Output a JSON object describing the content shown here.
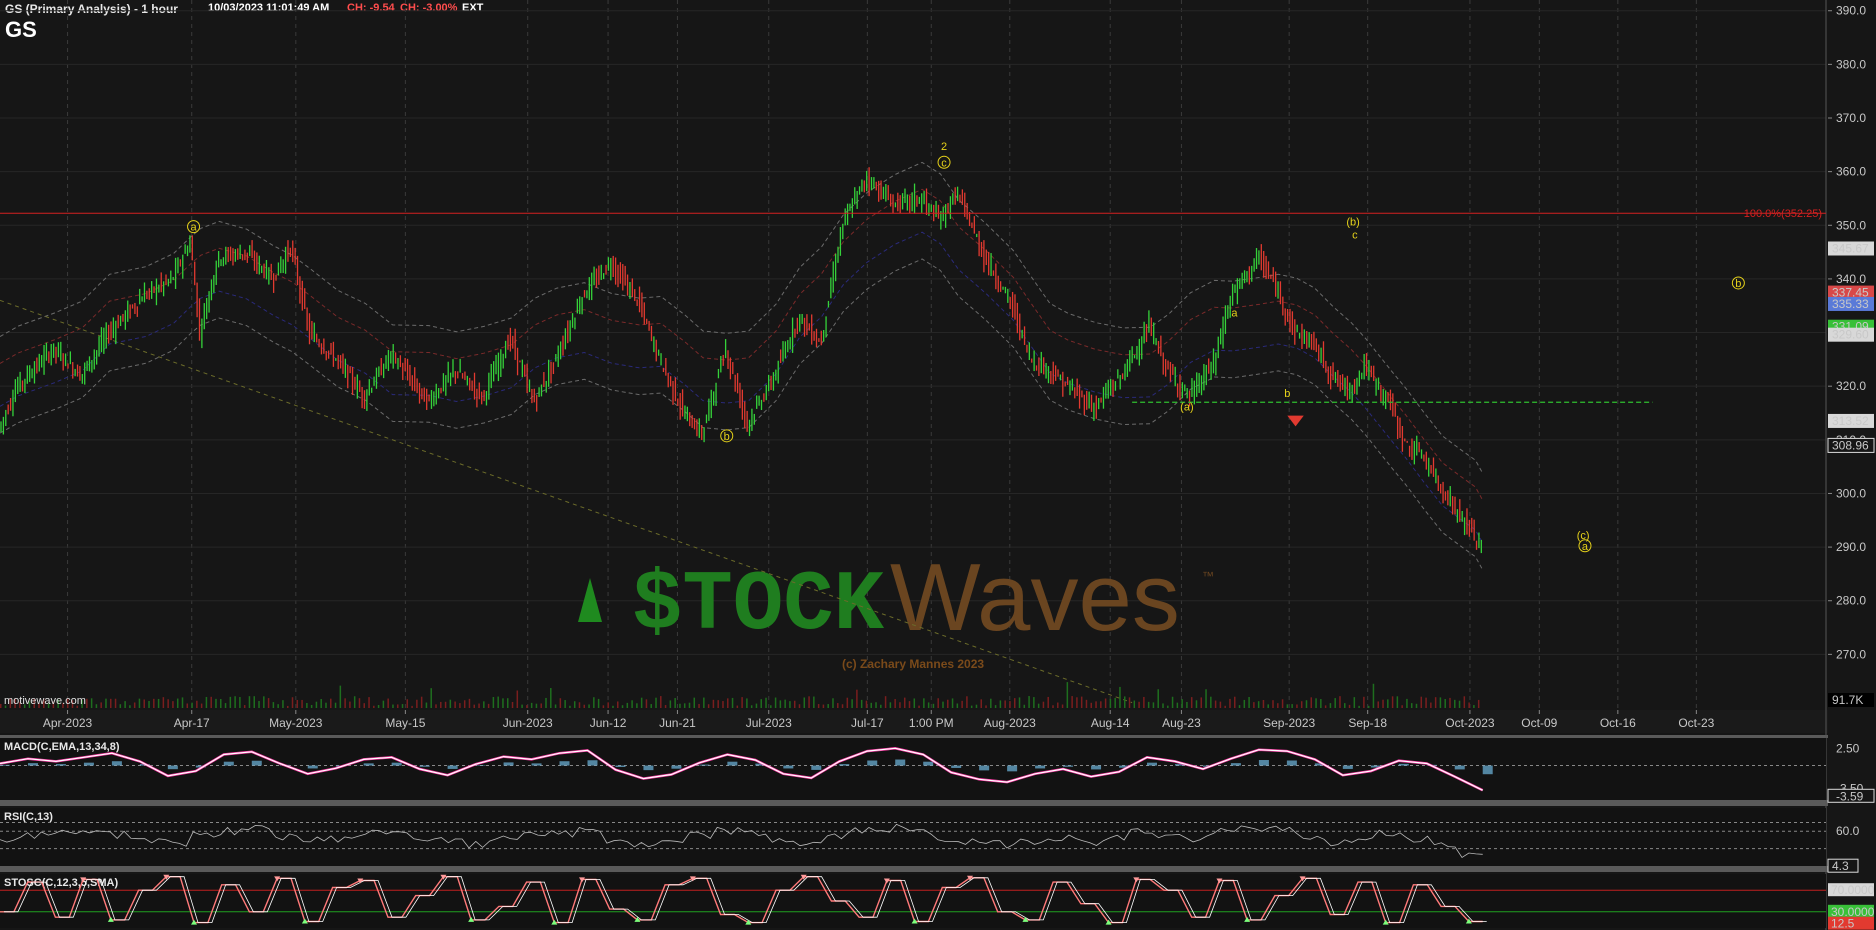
{
  "header": {
    "title": "GS (Primary Analysis) - 1 hour",
    "symbol": "GS",
    "timestamp": "10/03/2023 11:01:49 AM",
    "change": "CH: -9.54",
    "change_pct": "CH: -3.00%",
    "session": "EXT"
  },
  "watermark": {
    "source": "motivewave.com",
    "logo_part1": "$TOCK",
    "logo_part2": "Waves",
    "trademark": "™",
    "copyright": "(c) Zachary Mannes 2023"
  },
  "colors": {
    "background": "#161616",
    "grid": "#3a3a3a",
    "up": "#35d23a",
    "down": "#e23a30",
    "wave_label": "#e6d21a",
    "fib_line": "#d42020",
    "support_line": "#2fbf2f",
    "macd": "#ffffff",
    "macd_signal": "#ff3ca8",
    "macd_hist": "#6fb8e0",
    "stoch_k": "#ff7a7a",
    "stoch_d": "#ffffff"
  },
  "chart_data": [
    {
      "type": "line",
      "name": "price",
      "ylim": [
        260,
        392
      ],
      "y_ticks": [
        270,
        280,
        290,
        300,
        310,
        320,
        330,
        340,
        350,
        360,
        370,
        380,
        390
      ],
      "x_labels": [
        "Apr-2023",
        "Apr-17",
        "May-2023",
        "May-15",
        "Jun-2023",
        "Jun-12",
        "Jun-21",
        "Jul-2023",
        "Jul-17",
        "1:00 PM",
        "Aug-2023",
        "Aug-14",
        "Aug-23",
        "Sep-2023",
        "Sep-18",
        "Oct-2023",
        "Oct-09",
        "Oct-16",
        "Oct-23"
      ],
      "x_positions": [
        0.037,
        0.105,
        0.162,
        0.222,
        0.289,
        0.333,
        0.371,
        0.421,
        0.475,
        0.51,
        0.553,
        0.608,
        0.647,
        0.706,
        0.749,
        0.805,
        0.843,
        0.886,
        0.929
      ],
      "series": [
        {
          "x": [
            0.0,
            0.01,
            0.03,
            0.045,
            0.06,
            0.08,
            0.095,
            0.105,
            0.11,
            0.12,
            0.135,
            0.15,
            0.16,
            0.17,
            0.185,
            0.2,
            0.215,
            0.235,
            0.25,
            0.265,
            0.28,
            0.293,
            0.305,
            0.32,
            0.335,
            0.35,
            0.362,
            0.375,
            0.385,
            0.398,
            0.41,
            0.425,
            0.438,
            0.45,
            0.462,
            0.475,
            0.49,
            0.505,
            0.515,
            0.525,
            0.54,
            0.555,
            0.565,
            0.575,
            0.585,
            0.6,
            0.615,
            0.63,
            0.64,
            0.652,
            0.665,
            0.675,
            0.69,
            0.7,
            0.71,
            0.72,
            0.73,
            0.74,
            0.748,
            0.755,
            0.762,
            0.77,
            0.78,
            0.79,
            0.8,
            0.808,
            0.812
          ],
          "y": [
            312,
            320,
            327,
            322,
            330,
            337,
            340,
            347,
            330,
            344,
            345,
            340,
            346,
            330,
            325,
            318,
            326,
            317,
            323,
            318,
            329,
            317,
            325,
            337,
            343,
            336,
            325,
            315,
            311,
            327,
            313,
            322,
            333,
            328,
            350,
            359,
            354,
            355,
            351,
            356,
            344,
            335,
            325,
            323,
            320,
            316,
            322,
            331,
            323,
            318,
            324,
            337,
            344,
            338,
            330,
            328,
            322,
            319,
            324,
            320,
            317,
            309,
            307,
            301,
            296,
            292,
            290
          ]
        },
        {
          "name": "High",
          "values": [
            346.7
          ]
        },
        {
          "name": "Low",
          "values": [
            290.9
          ]
        }
      ],
      "labels": {
        "fib": "100.0%(352.25)",
        "price_tags": [
          "345.67",
          "337.45",
          "335.33",
          "331.09",
          "329.60",
          "313.52",
          "308.96",
          "91.7K"
        ],
        "waves": [
          {
            "text": "a",
            "x": 0.106,
            "y": 349
          },
          {
            "text": "b",
            "x": 0.398,
            "y": 310
          },
          {
            "text": "c",
            "x": 0.517,
            "y": 361
          },
          {
            "text": "2",
            "x": 0.517,
            "y": 364
          },
          {
            "text": "(a)",
            "x": 0.65,
            "y": 315.5
          },
          {
            "text": "a",
            "x": 0.676,
            "y": 333
          },
          {
            "text": "b",
            "x": 0.705,
            "y": 318
          },
          {
            "text": "(b)",
            "x": 0.741,
            "y": 350
          },
          {
            "text": "c",
            "x": 0.742,
            "y": 347.5
          },
          {
            "text": "(c)",
            "x": 0.867,
            "y": 291.5
          },
          {
            "text": "a",
            "x": 0.868,
            "y": 289.5
          },
          {
            "text": "b",
            "x": 0.952,
            "y": 338.5
          }
        ]
      }
    },
    {
      "type": "line",
      "name": "MACD",
      "label": "MACD(C,EMA,13,34,8)",
      "ylim": [
        -5,
        4
      ],
      "y_ticks_labels": [
        "2.50",
        "-3.50",
        "-3.59"
      ],
      "values": [
        0.3,
        1.0,
        0.6,
        1.2,
        1.8,
        0.6,
        -1.5,
        -0.8,
        1.6,
        2.0,
        0.3,
        -1.2,
        -0.4,
        0.9,
        1.2,
        -0.5,
        -1.4,
        0.2,
        1.3,
        0.9,
        1.8,
        2.2,
        -0.6,
        -1.9,
        -1.3,
        0.4,
        1.6,
        0.8,
        -1.2,
        -1.8,
        0.6,
        2.1,
        2.5,
        1.6,
        -1.0,
        -2.0,
        -2.4,
        -1.2,
        -0.5,
        -1.6,
        -0.9,
        1.2,
        0.6,
        -0.5,
        1.0,
        2.3,
        2.1,
        0.9,
        -1.4,
        -0.8,
        0.7,
        0.3,
        -1.6,
        -3.59
      ]
    },
    {
      "type": "line",
      "name": "RSI",
      "label": "RSI(C,13)",
      "ylim": [
        0,
        100
      ],
      "y_ticks_labels": [
        "60.0",
        "4.3"
      ],
      "values": [
        48,
        52,
        58,
        62,
        54,
        45,
        40,
        55,
        60,
        63,
        52,
        44,
        48,
        56,
        60,
        47,
        42,
        36,
        50,
        58,
        54,
        62,
        44,
        35,
        40,
        52,
        61,
        55,
        45,
        38,
        52,
        61,
        65,
        58,
        46,
        40,
        38,
        44,
        50,
        42,
        48,
        60,
        52,
        46,
        58,
        66,
        62,
        51,
        40,
        45,
        56,
        48,
        36,
        20
      ]
    },
    {
      "type": "line",
      "name": "STOSC",
      "label": "STOSC(C,12,3,5,SMA)",
      "ylim": [
        0,
        100
      ],
      "y_ticks_labels": [
        "70.0000",
        "30.0000",
        "12.5"
      ],
      "values": [
        30,
        85,
        20,
        90,
        15,
        70,
        95,
        10,
        80,
        30,
        92,
        12,
        75,
        88,
        20,
        60,
        95,
        15,
        40,
        85,
        10,
        90,
        35,
        15,
        80,
        92,
        25,
        10,
        70,
        95,
        50,
        20,
        88,
        12,
        75,
        93,
        30,
        15,
        85,
        45,
        10,
        90,
        70,
        20,
        88,
        15,
        60,
        92,
        25,
        85,
        10,
        80,
        40,
        12
      ]
    }
  ]
}
